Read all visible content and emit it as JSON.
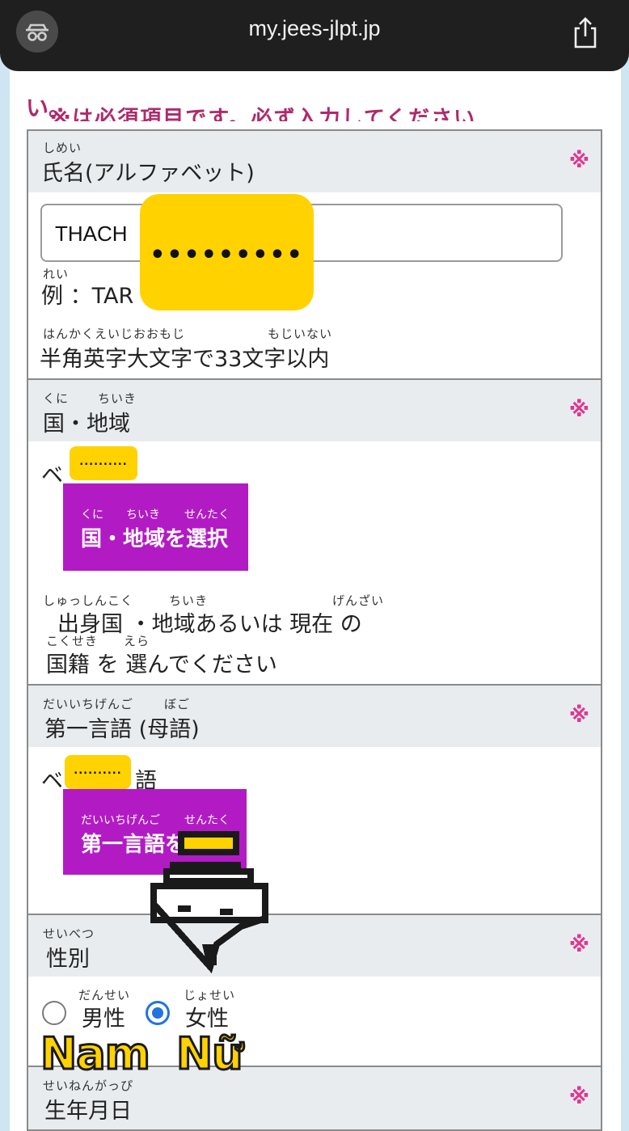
{
  "browser": {
    "url": "my.jees-jlpt.jp",
    "reader_icon": "reader-mode-icon",
    "share_icon": "share-icon"
  },
  "notice": {
    "top_line": "※は必須項目です。必ず入力してください",
    "line2": "い。"
  },
  "sections": {
    "name": {
      "ruby": "しめい",
      "label": "氏名(アルファベット)",
      "required": "※"
    },
    "name_body": {
      "input_value": "THACH",
      "censor": "•••••••••",
      "example_ruby": "れい",
      "example": "例 ：TAR",
      "hint_ruby_1": "はんかくえいじおおもじ",
      "hint_ruby_2": "もじいない",
      "hint": "半角英字大文字で33文字以内"
    },
    "country": {
      "ruby_1": "くに",
      "ruby_2": "ちいき",
      "label": "国・地域",
      "required": "※"
    },
    "country_body": {
      "value_prefix": "ベ",
      "censor": "..........",
      "button_ruby_1": "くに",
      "button_ruby_2": "ちいき",
      "button_ruby_3": "せんたく",
      "button_label": "国・地域を選択",
      "hint1_ruby_1": "しゅっしんこく",
      "hint1_ruby_2": "ちいき",
      "hint1_ruby_3": "げんざい",
      "hint1": "出身国 ・地域あるいは 現在 の",
      "hint2_ruby_1": "こくせき",
      "hint2_ruby_2": "えら",
      "hint2": "国籍 を 選んでください"
    },
    "language": {
      "ruby_1": "だいいちげんご",
      "ruby_2": "ぼご",
      "label": "第一言語 (母語)",
      "required": "※"
    },
    "language_body": {
      "value_prefix": "ベ",
      "censor": "..........",
      "value_suffix": "語",
      "button_ruby_1": "だいいちげんご",
      "button_ruby_2": "せんたく",
      "button_label": "第一言語を"
    },
    "gender": {
      "ruby": "せいべつ",
      "label": "性別",
      "required": "※"
    },
    "gender_body": {
      "male_ruby": "だんせい",
      "male": "男性",
      "female_ruby": "じょせい",
      "female": "女性",
      "selected": "女性"
    },
    "birthdate": {
      "ruby": "せいねんがっぴ",
      "label": "生年月日",
      "required": "※"
    }
  },
  "overlay": {
    "nam": "Nam",
    "nu": "Nữ",
    "cursor_icon": "pixel-hand-cursor-icon"
  },
  "colors": {
    "required": "#e0368f",
    "button": "#b21bc4",
    "censor": "#ffd200",
    "radio_selected": "#1f74e0"
  }
}
